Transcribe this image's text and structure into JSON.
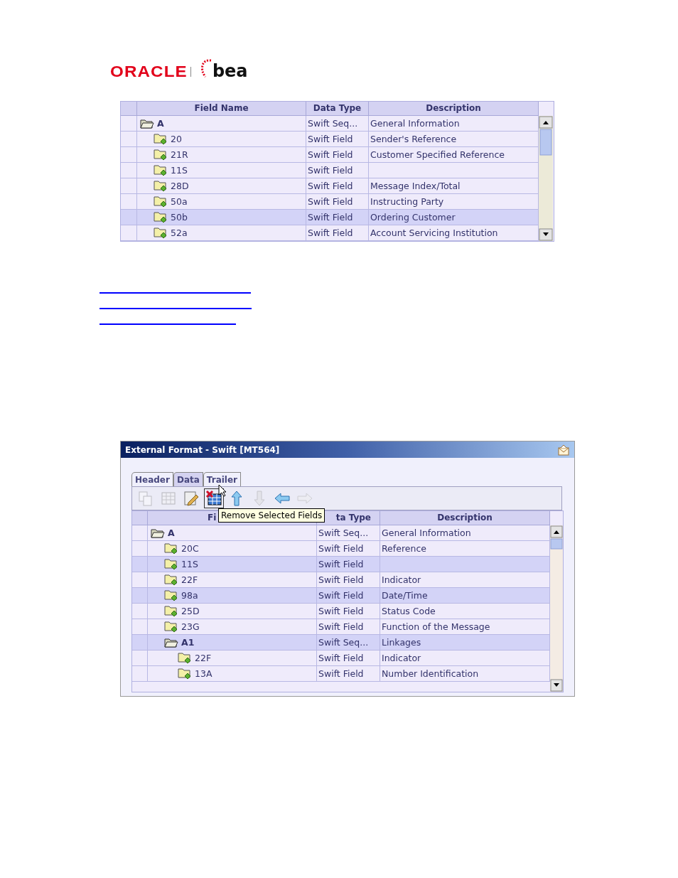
{
  "logo": {
    "oracle": "ORACLE",
    "bea": "bea"
  },
  "field_table": {
    "columns": [
      "Field Name",
      "Data Type",
      "Description"
    ],
    "rows": [
      {
        "name": "A",
        "kind": "sequence",
        "type": "Swift Seq...",
        "description": "General Information",
        "selected": false,
        "children": [
          {
            "name": "20",
            "kind": "field",
            "type": "Swift Field",
            "description": "Sender's Reference",
            "selected": false
          },
          {
            "name": "21R",
            "kind": "field",
            "type": "Swift Field",
            "description": "Customer Specified Reference",
            "selected": false
          },
          {
            "name": "11S",
            "kind": "field",
            "type": "Swift Field",
            "selected": false
          },
          {
            "name": "28D",
            "kind": "field",
            "type": "Swift Field",
            "description": "Message Index/Total",
            "selected": false
          },
          {
            "name": "50a",
            "kind": "field",
            "type": "Swift Field",
            "description": "Instructing Party",
            "selected": false
          },
          {
            "name": "50b",
            "kind": "field",
            "type": "Swift Field",
            "description": "Ordering Customer",
            "selected": true
          },
          {
            "name": "52a",
            "kind": "field",
            "type": "Swift Field",
            "description": "Account Servicing Institution",
            "selected": false
          }
        ]
      }
    ]
  },
  "links": [
    {
      "kind": "link"
    },
    {
      "kind": "link"
    },
    {
      "kind": "link"
    }
  ],
  "window": {
    "title": "External Format - Swift [MT564]",
    "tabs": [
      {
        "label": "Header",
        "selected": false
      },
      {
        "label": "Data",
        "selected": true
      },
      {
        "label": "Trailer",
        "selected": false
      }
    ],
    "toolbar": [
      {
        "kind": "copy",
        "disabled": true
      },
      {
        "kind": "grid",
        "disabled": true
      },
      {
        "kind": "edit",
        "disabled": false
      },
      {
        "kind": "remove",
        "disabled": false
      },
      {
        "kind": "up",
        "disabled": false
      },
      {
        "kind": "down",
        "disabled": true
      },
      {
        "kind": "left",
        "disabled": false
      },
      {
        "kind": "right",
        "disabled": true
      }
    ],
    "tooltip": "Remove Selected Fields",
    "data_table": {
      "columns": [
        "Fi",
        "ta Type",
        "Description"
      ],
      "rows": [
        {
          "name": "A",
          "kind": "sequence",
          "type": "Swift Seq...",
          "description": "General Information",
          "selected": false,
          "children": [
            {
              "name": "20C",
              "kind": "field",
              "type": "Swift Field",
              "description": "Reference",
              "selected": false
            },
            {
              "name": "11S",
              "kind": "field",
              "type": "Swift Field",
              "selected": true
            },
            {
              "name": "22F",
              "kind": "field",
              "type": "Swift Field",
              "description": "Indicator",
              "selected": false
            },
            {
              "name": "98a",
              "kind": "field",
              "type": "Swift Field",
              "description": "Date/Time",
              "selected": true
            },
            {
              "name": "25D",
              "kind": "field",
              "type": "Swift Field",
              "description": "Status Code",
              "selected": false
            },
            {
              "name": "23G",
              "kind": "field",
              "type": "Swift Field",
              "description": "Function of the Message",
              "selected": false
            },
            {
              "name": "A1",
              "kind": "sequence",
              "type": "Swift Seq...",
              "description": "Linkages",
              "selected": true,
              "children": [
                {
                  "name": "22F",
                  "kind": "field",
                  "type": "Swift Field",
                  "description": "Indicator",
                  "selected": false
                },
                {
                  "name": "13A",
                  "kind": "field",
                  "type": "Swift Field",
                  "description": "Number Identification",
                  "selected": false
                }
              ]
            }
          ]
        }
      ]
    }
  }
}
